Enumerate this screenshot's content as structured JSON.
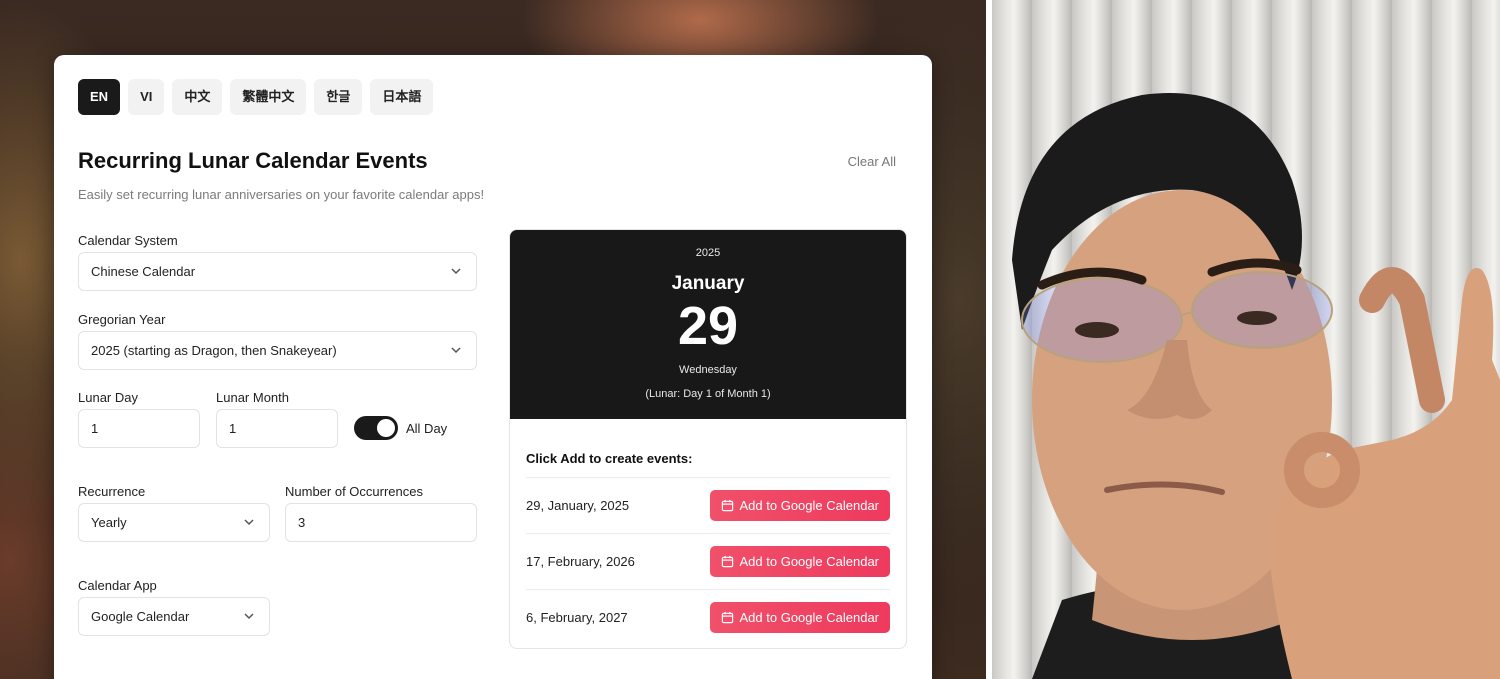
{
  "languages": [
    {
      "label": "EN",
      "active": true
    },
    {
      "label": "VI",
      "active": false
    },
    {
      "label": "中文",
      "active": false
    },
    {
      "label": "繁體中文",
      "active": false
    },
    {
      "label": "한글",
      "active": false
    },
    {
      "label": "日本語",
      "active": false
    }
  ],
  "header": {
    "title": "Recurring Lunar Calendar Events",
    "subtitle": "Easily set recurring lunar anniversaries on your favorite calendar apps!",
    "clear_label": "Clear All"
  },
  "form": {
    "calendar_system": {
      "label": "Calendar System",
      "value": "Chinese Calendar"
    },
    "gregorian_year": {
      "label": "Gregorian Year",
      "value": "2025 (starting as Dragon, then Snakeyear)"
    },
    "lunar_day": {
      "label": "Lunar Day",
      "value": "1"
    },
    "lunar_month": {
      "label": "Lunar Month",
      "value": "1"
    },
    "all_day": {
      "label": "All Day",
      "on": true
    },
    "recurrence": {
      "label": "Recurrence",
      "value": "Yearly"
    },
    "occurrences": {
      "label": "Number of Occurrences",
      "value": "3"
    },
    "calendar_app": {
      "label": "Calendar App",
      "value": "Google Calendar"
    }
  },
  "preview": {
    "year": "2025",
    "month": "January",
    "day": "29",
    "weekday": "Wednesday",
    "lunar": "(Lunar: Day 1 of Month 1)"
  },
  "events": {
    "heading": "Click Add to create events:",
    "button_label": "Add to Google Calendar",
    "items": [
      {
        "date": "29, January, 2025"
      },
      {
        "date": "17, February, 2026"
      },
      {
        "date": "6, February, 2027"
      }
    ]
  },
  "colors": {
    "accent": "#ee3a5e",
    "dark": "#181818"
  }
}
